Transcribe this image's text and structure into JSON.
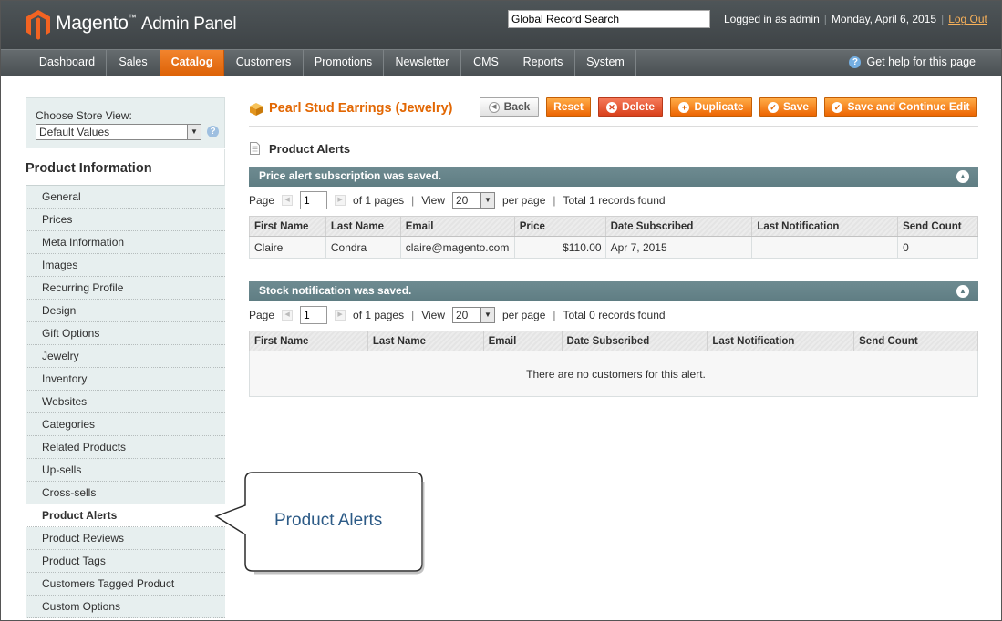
{
  "header": {
    "brand": "Magento",
    "brand_suffix": "Admin Panel",
    "search_value": "Global Record Search",
    "logged_in": "Logged in as admin",
    "date": "Monday, April 6, 2015",
    "logout": "Log Out"
  },
  "nav": {
    "items": [
      "Dashboard",
      "Sales",
      "Catalog",
      "Customers",
      "Promotions",
      "Newsletter",
      "CMS",
      "Reports",
      "System"
    ],
    "active": "Catalog",
    "help": "Get help for this page"
  },
  "sidebar": {
    "store_label": "Choose Store View:",
    "store_value": "Default Values",
    "title": "Product Information",
    "items": [
      "General",
      "Prices",
      "Meta Information",
      "Images",
      "Recurring Profile",
      "Design",
      "Gift Options",
      "Jewelry",
      "Inventory",
      "Websites",
      "Categories",
      "Related Products",
      "Up-sells",
      "Cross-sells",
      "Product Alerts",
      "Product Reviews",
      "Product Tags",
      "Customers Tagged Product",
      "Custom Options"
    ],
    "active": "Product Alerts"
  },
  "callout": {
    "text": "Product Alerts"
  },
  "page": {
    "title": "Pearl Stud Earrings (Jewelry)",
    "buttons": {
      "back": "Back",
      "reset": "Reset",
      "delete": "Delete",
      "duplicate": "Duplicate",
      "save": "Save",
      "save_continue": "Save and Continue Edit"
    },
    "section_title": "Product Alerts"
  },
  "price_alert": {
    "title": "Price alert subscription was saved.",
    "pager": {
      "page_label": "Page",
      "page": "1",
      "of_pages": "of 1 pages",
      "view_label": "View",
      "view": "20",
      "per_page": "per page",
      "total": "Total 1 records found"
    },
    "columns": [
      "First Name",
      "Last Name",
      "Email",
      "Price",
      "Date Subscribed",
      "Last Notification",
      "Send Count"
    ],
    "rows": [
      [
        "Claire",
        "Condra",
        "claire@magento.com",
        "$110.00",
        "Apr 7, 2015",
        "",
        "0"
      ]
    ]
  },
  "stock_alert": {
    "title": "Stock notification was saved.",
    "pager": {
      "page_label": "Page",
      "page": "1",
      "of_pages": "of 1 pages",
      "view_label": "View",
      "view": "20",
      "per_page": "per page",
      "total": "Total 0 records found"
    },
    "columns": [
      "First Name",
      "Last Name",
      "Email",
      "Date Subscribed",
      "Last Notification",
      "Send Count"
    ],
    "empty": "There are no customers for this alert."
  },
  "colors": {
    "accent": "#e26703",
    "header_bg": "#464c4f",
    "bar_bg": "#6a868c"
  }
}
